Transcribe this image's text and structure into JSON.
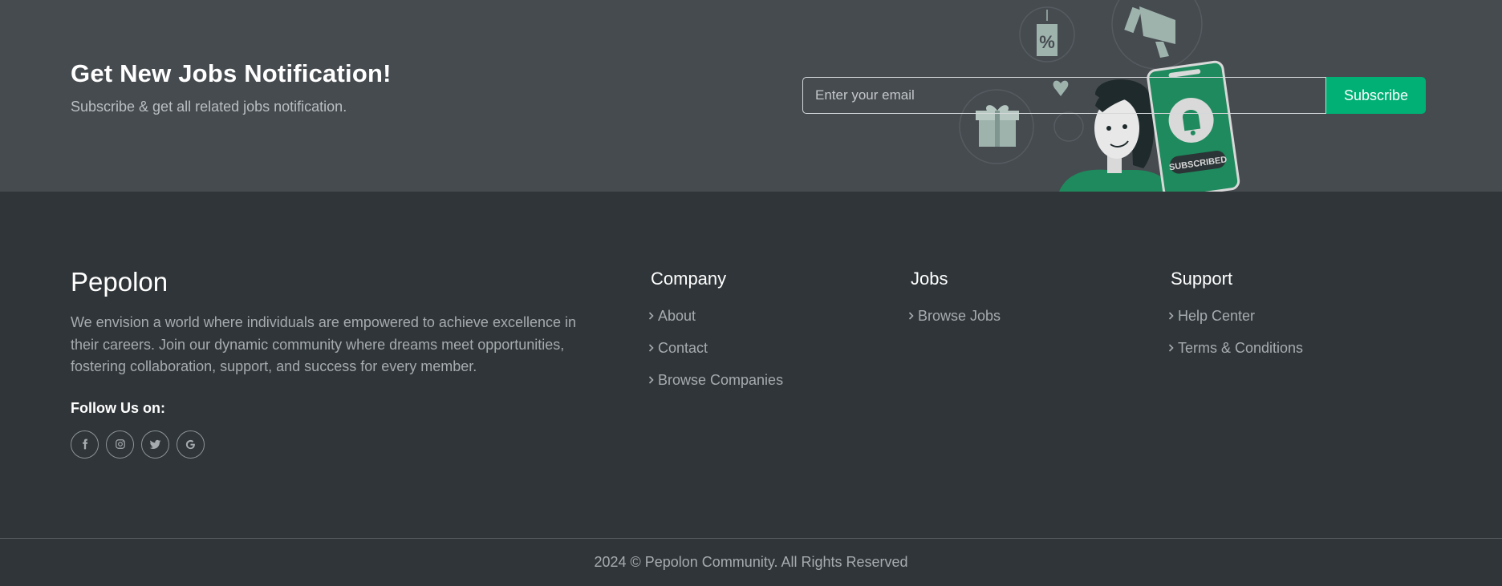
{
  "newsletter": {
    "title": "Get New Jobs Notification!",
    "subtitle": "Subscribe & get all related jobs notification.",
    "email_placeholder": "Enter your email",
    "subscribe_label": "Subscribe",
    "illustration_badge": "SUBSCRIBED",
    "illustration_tag": "%"
  },
  "footer": {
    "brand": "Pepolon",
    "description": "We envision a world where individuals are empowered to achieve excellence in their careers. Join our dynamic community where dreams meet opportunities, fostering collaboration, support, and success for every member.",
    "follow_label": "Follow Us on:",
    "socials": [
      "facebook-icon",
      "instagram-icon",
      "twitter-icon",
      "google-icon"
    ],
    "columns": {
      "company": {
        "title": "Company",
        "links": [
          "About",
          "Contact",
          "Browse Companies"
        ]
      },
      "jobs": {
        "title": "Jobs",
        "links": [
          "Browse Jobs"
        ]
      },
      "support": {
        "title": "Support",
        "links": [
          "Help Center",
          "Terms & Conditions"
        ]
      }
    },
    "copyright": "2024 © Pepolon Community. All Rights Reserved"
  },
  "colors": {
    "accent": "#00b074",
    "newsletter_bg": "#464b50",
    "footer_bg": "#2f3538",
    "muted_text": "#a5abaf"
  }
}
